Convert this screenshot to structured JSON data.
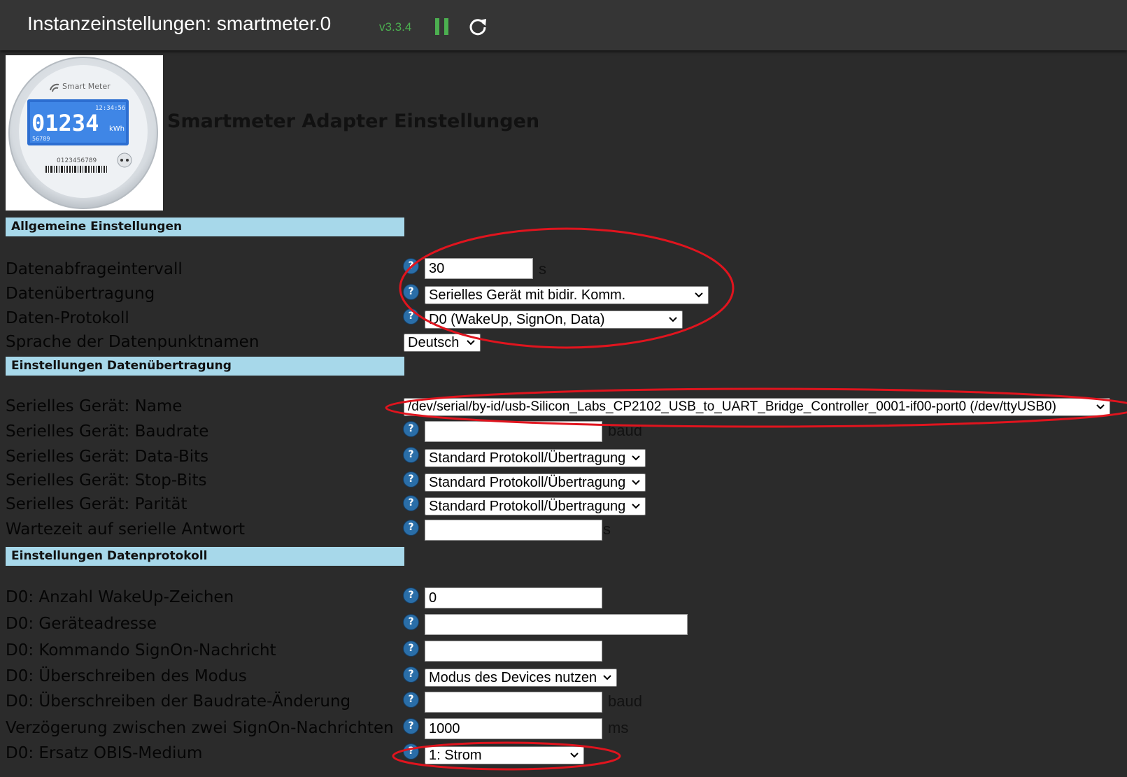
{
  "header": {
    "title": "Instanzeinstellungen: smartmeter.0",
    "version": "v3.3.4"
  },
  "logo": {
    "brand": "Smart Meter",
    "time": "12:34:56",
    "reading": "01234",
    "unit": "kWh",
    "sub_number": "56789",
    "serial": "0123456789"
  },
  "page_title": "Smartmeter Adapter Einstellungen",
  "sections": {
    "general": "Allgemeine Einstellungen",
    "transfer": "Einstellungen Datenübertragung",
    "protocol": "Einstellungen Datenprotokoll"
  },
  "help_glyph": "?",
  "fields": {
    "interval": {
      "label": "Datenabfrageintervall",
      "value": "30",
      "unit": "s"
    },
    "transfer": {
      "label": "Datenübertragung",
      "value": "Serielles Gerät mit bidir. Komm."
    },
    "protocol": {
      "label": "Daten-Protokoll",
      "value": "D0 (WakeUp, SignOn, Data)"
    },
    "language": {
      "label": "Sprache der Datenpunktnamen",
      "value": "Deutsch"
    },
    "serial_name": {
      "label": "Serielles Gerät: Name",
      "value": "/dev/serial/by-id/usb-Silicon_Labs_CP2102_USB_to_UART_Bridge_Controller_0001-if00-port0 (/dev/ttyUSB0)"
    },
    "baudrate": {
      "label": "Serielles Gerät: Baudrate",
      "value": "",
      "unit": "baud"
    },
    "databits": {
      "label": "Serielles Gerät: Data-Bits",
      "value": "Standard Protokoll/Übertragung"
    },
    "stopbits": {
      "label": "Serielles Gerät: Stop-Bits",
      "value": "Standard Protokoll/Übertragung"
    },
    "parity": {
      "label": "Serielles Gerät: Parität",
      "value": "Standard Protokoll/Übertragung"
    },
    "wait": {
      "label": "Wartezeit auf serielle Antwort",
      "value": "",
      "unit": "s"
    },
    "wakeup": {
      "label": "D0: Anzahl WakeUp-Zeichen",
      "value": "0"
    },
    "address": {
      "label": "D0: Geräteadresse",
      "value": ""
    },
    "signon": {
      "label": "D0: Kommando SignOn-Nachricht",
      "value": ""
    },
    "mode": {
      "label": "D0: Überschreiben des Modus",
      "value": "Modus des Devices nutzen"
    },
    "baud_change": {
      "label": "D0: Überschreiben der Baudrate-Änderung",
      "value": "",
      "unit": "baud"
    },
    "delay": {
      "label": "Verzögerung zwischen zwei SignOn-Nachrichten",
      "value": "1000",
      "unit": "ms"
    },
    "obis": {
      "label": "D0: Ersatz OBIS-Medium",
      "value": "1: Strom"
    }
  },
  "colors": {
    "background": "#2b2b2b",
    "header": "#353535",
    "section": "#a7d8ea",
    "accent": "#4caf50",
    "help": "#2a6ea8",
    "annotation": "#e0141e"
  },
  "icons": [
    "pause-icon",
    "refresh-icon",
    "help-icon",
    "chevron-down-icon"
  ]
}
